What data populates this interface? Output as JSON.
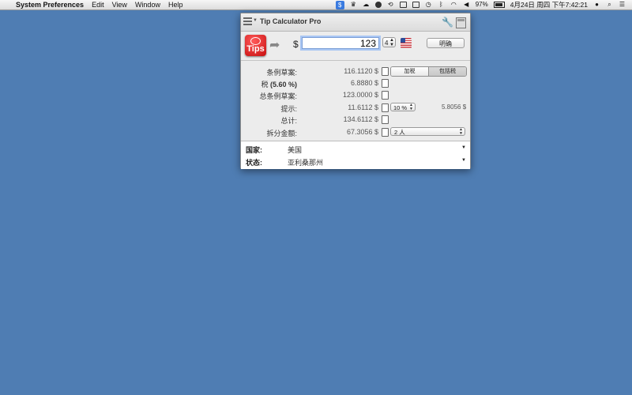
{
  "menubar": {
    "app_name": "System Preferences",
    "menus": [
      "Edit",
      "View",
      "Window",
      "Help"
    ],
    "battery_percent": "97%",
    "clock": "4月24日 周四 下午7:42:21"
  },
  "panel": {
    "title": "Tip Calculator Pro",
    "app_icon_label": "Tips",
    "currency_symbol": "$",
    "amount": "123",
    "decimals": "4",
    "clear_label": "明确"
  },
  "results": {
    "subtotal": {
      "label": "条例草案:",
      "value": "116.1120 $"
    },
    "tax": {
      "label": "税",
      "rate": "(5.60 %)",
      "value": "6.8880 $"
    },
    "total_bill": {
      "label": "总条例草案:",
      "value": "123.0000 $"
    },
    "tip": {
      "label": "提示:",
      "value": "11.6112 $",
      "percent": "10 %",
      "per_person": "5.8056 $"
    },
    "grand_total": {
      "label": "总计:",
      "value": "134.6112 $"
    },
    "split": {
      "label": "拆分金额:",
      "value": "67.3056 $",
      "people": "2 人"
    },
    "tax_mode": {
      "options": [
        "加税",
        "包括税"
      ],
      "selected": "包括税"
    }
  },
  "location": {
    "country_label": "国家:",
    "country": "美国",
    "state_label": "状态:",
    "state": "亚利桑那州"
  }
}
